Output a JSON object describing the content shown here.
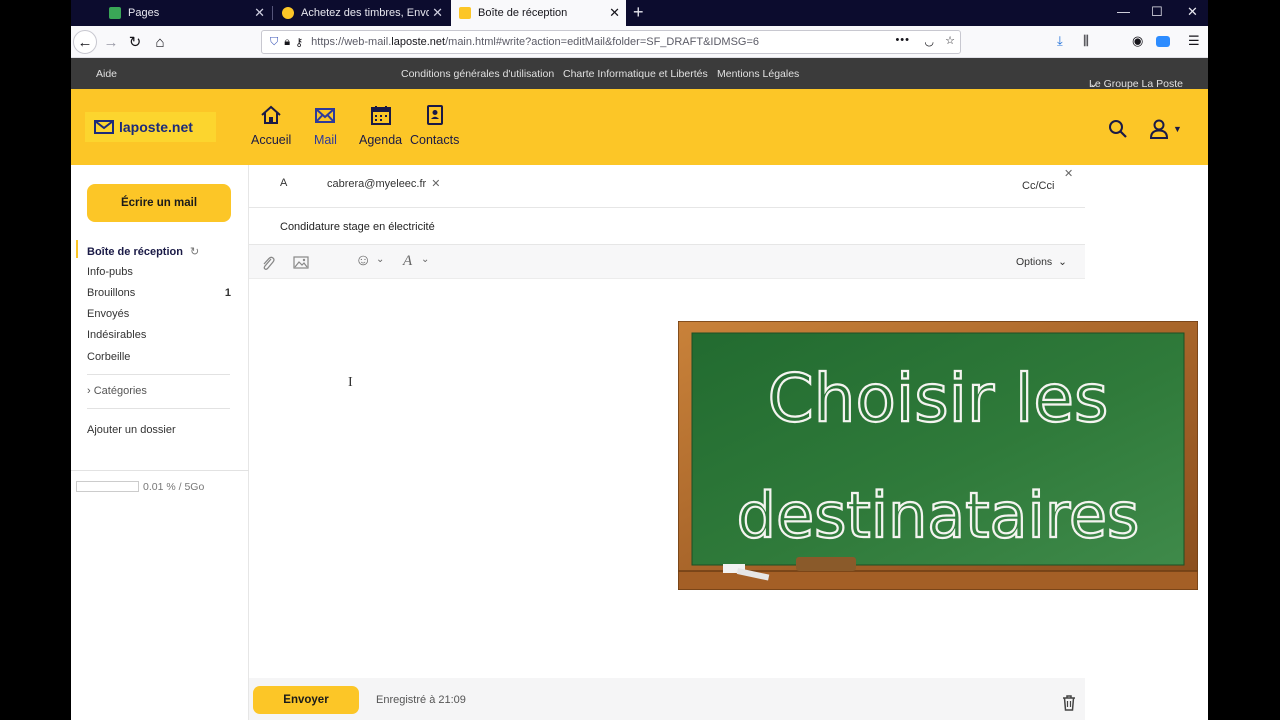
{
  "browser": {
    "tabs": [
      {
        "label": "Pages",
        "active": false
      },
      {
        "label": "Achetez des timbres, Envoyez C",
        "active": false
      },
      {
        "label": "Boîte de réception",
        "active": true
      }
    ],
    "url": {
      "prefix": "https://web-mail.",
      "host": "laposte.net",
      "path": "/main.html#write?action=editMail&folder=SF_DRAFT&IDMSG=6"
    }
  },
  "topbar": {
    "help": "Aide",
    "links": [
      "Conditions générales d'utilisation",
      "Charte Informatique et Libertés",
      "Mentions Légales"
    ],
    "group": "Le Groupe La Poste"
  },
  "header": {
    "logo": "laposte.net",
    "nav": [
      {
        "label": "Accueil",
        "icon": "home-icon"
      },
      {
        "label": "Mail",
        "icon": "mail-icon"
      },
      {
        "label": "Agenda",
        "icon": "calendar-icon"
      },
      {
        "label": "Contacts",
        "icon": "contacts-icon"
      }
    ]
  },
  "sidebar": {
    "compose_label": "Écrire un mail",
    "folders": [
      {
        "label": "Boîte de réception",
        "count": ""
      },
      {
        "label": "Info-pubs",
        "count": ""
      },
      {
        "label": "Brouillons",
        "count": "1"
      },
      {
        "label": "Envoyés",
        "count": ""
      },
      {
        "label": "Indésirables",
        "count": ""
      },
      {
        "label": "Corbeille",
        "count": ""
      }
    ],
    "categories": "Catégories",
    "add_folder": "Ajouter un dossier",
    "quota": "0.01 % / 5Go"
  },
  "compose": {
    "to_label": "A",
    "recipient": "cabrera@myeleec.fr",
    "cc": "Cc/Cci",
    "subject": "Condidature stage en électricité",
    "options": "Options",
    "send": "Envoyer",
    "saved": "Enregistré à 21:09"
  },
  "overlay": {
    "line1": "Choisir les",
    "line2": "destinataires"
  },
  "colors": {
    "accent": "#fcc627",
    "board": "#2f7a3a",
    "frame": "#a8652a"
  }
}
